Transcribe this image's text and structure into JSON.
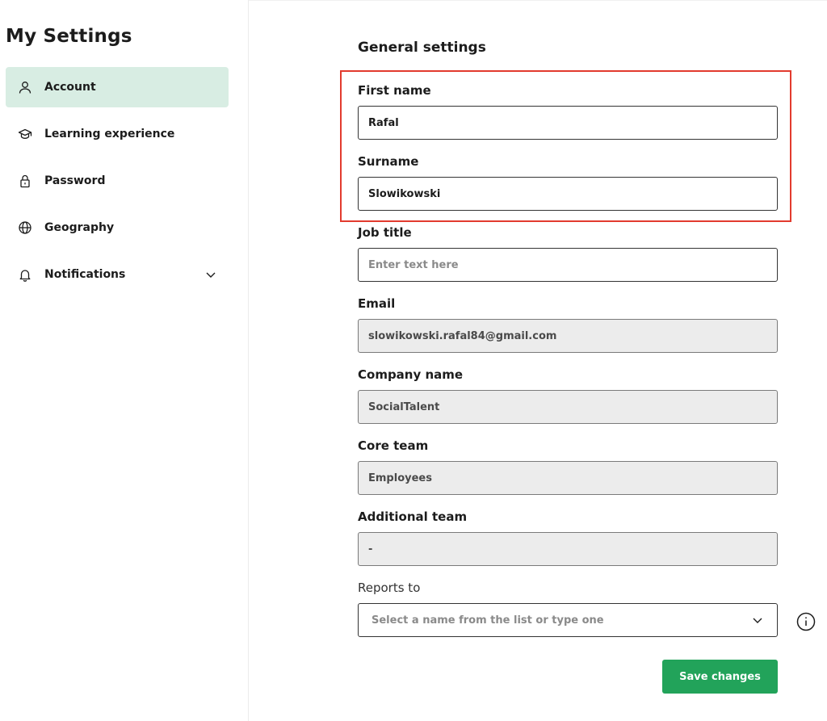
{
  "sidebar": {
    "title": "My Settings",
    "items": [
      {
        "label": "Account",
        "icon": "user-icon",
        "active": true
      },
      {
        "label": "Learning experience",
        "icon": "graduation-cap-icon"
      },
      {
        "label": "Password",
        "icon": "lock-icon"
      },
      {
        "label": "Geography",
        "icon": "globe-icon"
      },
      {
        "label": "Notifications",
        "icon": "bell-icon",
        "expandable": true
      }
    ]
  },
  "main": {
    "section_title": "General settings",
    "fields": {
      "first_name": {
        "label": "First name",
        "value": "Rafal"
      },
      "surname": {
        "label": "Surname",
        "value": "Slowikowski"
      },
      "job_title": {
        "label": "Job title",
        "value": "",
        "placeholder": "Enter text here"
      },
      "email": {
        "label": "Email",
        "value": "slowikowski.rafal84@gmail.com"
      },
      "company_name": {
        "label": "Company name",
        "value": "SocialTalent"
      },
      "core_team": {
        "label": "Core team",
        "value": "Employees"
      },
      "additional_team": {
        "label": "Additional team",
        "value": "-"
      },
      "reports_to": {
        "label": "Reports to",
        "placeholder": "Select a name from the list or type one"
      }
    },
    "save_label": "Save changes"
  },
  "colors": {
    "active_nav_bg": "#d8ede3",
    "primary_button": "#22a35a",
    "highlight_border": "#e23b2e",
    "readonly_bg": "#ececec"
  }
}
